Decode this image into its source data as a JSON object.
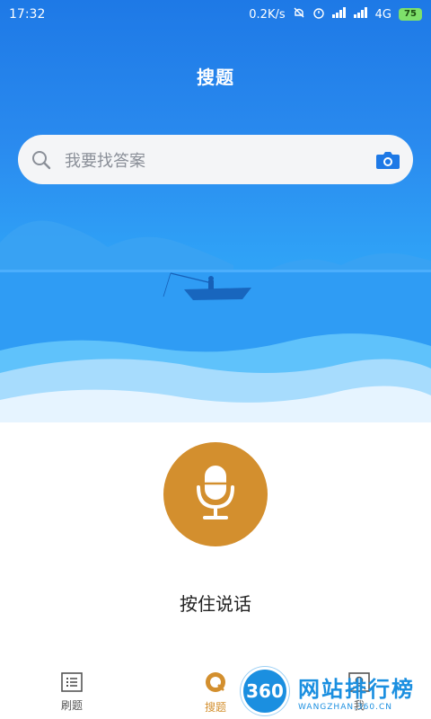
{
  "status_bar": {
    "time": "17:32",
    "net_speed": "0.2K/s",
    "network": "4G",
    "battery": "75"
  },
  "header": {
    "title": "搜题"
  },
  "search": {
    "placeholder": "我要找答案"
  },
  "voice": {
    "label": "按住说话"
  },
  "nav": {
    "items": [
      {
        "label": "刷题",
        "icon": "list-icon"
      },
      {
        "label": "搜题",
        "icon": "search-circle-icon"
      },
      {
        "label": "我",
        "icon": "profile-icon"
      }
    ],
    "active_index": 1
  },
  "watermark": {
    "logo": "360",
    "title": "网站排行榜",
    "subtitle": "WANGZHAN.360.CN"
  },
  "colors": {
    "primary": "#1e79e6",
    "accent": "#d38f2e",
    "search_bg": "#f4f5f7"
  }
}
